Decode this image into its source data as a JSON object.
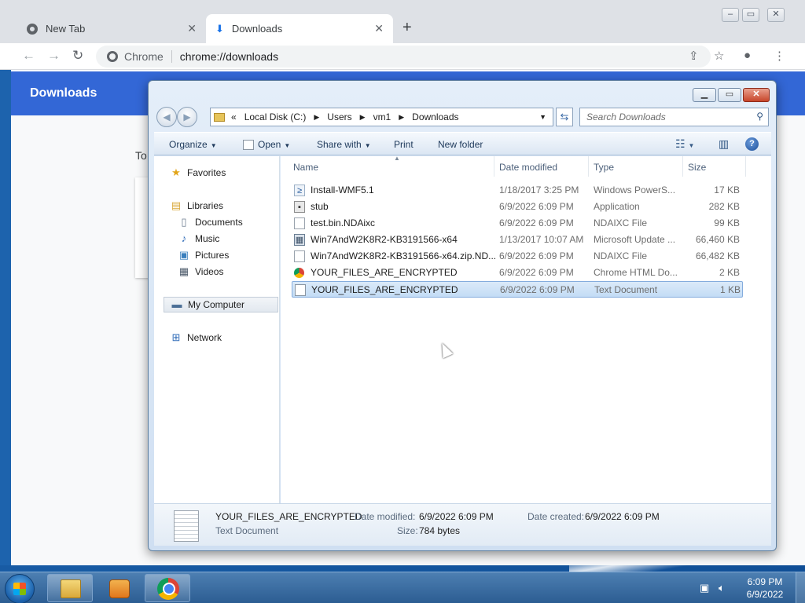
{
  "chrome": {
    "tabs": [
      {
        "label": "New Tab",
        "icon": "chrome-logo-icon"
      },
      {
        "label": "Downloads",
        "icon": "download-icon"
      }
    ],
    "omnibox": {
      "site": "Chrome",
      "url": "chrome://downloads"
    },
    "page_title": "Downloads",
    "partial_text": "To"
  },
  "explorer": {
    "breadcrumb": [
      "Local Disk (C:)",
      "Users",
      "vm1",
      "Downloads"
    ],
    "breadcrumb_prefix": "«",
    "search_placeholder": "Search Downloads",
    "toolbar": {
      "organize": "Organize",
      "open": "Open",
      "share_with": "Share with",
      "print": "Print",
      "new_folder": "New folder"
    },
    "nav": {
      "favorites": "Favorites",
      "libraries": "Libraries",
      "library_items": [
        "Documents",
        "Music",
        "Pictures",
        "Videos"
      ],
      "my_computer": "My Computer",
      "network": "Network"
    },
    "columns": [
      "Name",
      "Date modified",
      "Type",
      "Size"
    ],
    "files": [
      {
        "name": "Install-WMF5.1",
        "date": "1/18/2017 3:25 PM",
        "type": "Windows PowerS...",
        "size": "17 KB",
        "icon": "powershell-file-icon"
      },
      {
        "name": "stub",
        "date": "6/9/2022 6:09 PM",
        "type": "Application",
        "size": "282 KB",
        "icon": "application-icon"
      },
      {
        "name": "test.bin.NDAixc",
        "date": "6/9/2022 6:09 PM",
        "type": "NDAIXC File",
        "size": "99 KB",
        "icon": "blank-file-icon"
      },
      {
        "name": "Win7AndW2K8R2-KB3191566-x64",
        "date": "1/13/2017 10:07 AM",
        "type": "Microsoft Update ...",
        "size": "66,460 KB",
        "icon": "update-package-icon"
      },
      {
        "name": "Win7AndW2K8R2-KB3191566-x64.zip.ND...",
        "date": "6/9/2022 6:09 PM",
        "type": "NDAIXC File",
        "size": "66,482 KB",
        "icon": "blank-file-icon"
      },
      {
        "name": "YOUR_FILES_ARE_ENCRYPTED",
        "date": "6/9/2022 6:09 PM",
        "type": "Chrome HTML Do...",
        "size": "2 KB",
        "icon": "chrome-html-icon"
      },
      {
        "name": "YOUR_FILES_ARE_ENCRYPTED",
        "date": "6/9/2022 6:09 PM",
        "type": "Text Document",
        "size": "1 KB",
        "icon": "text-document-icon"
      }
    ],
    "selected_index": 6,
    "details": {
      "name": "YOUR_FILES_ARE_ENCRYPTED",
      "type": "Text Document",
      "date_modified_label": "Date modified:",
      "date_modified": "6/9/2022 6:09 PM",
      "date_created_label": "Date created:",
      "date_created": "6/9/2022 6:09 PM",
      "size_label": "Size:",
      "size": "784 bytes"
    }
  },
  "taskbar": {
    "time": "6:09 PM",
    "date": "6/9/2022"
  },
  "colors": {
    "chrome_header": "#3367d6",
    "selection": "#c3dcf5",
    "taskbar": "#2c5d92"
  }
}
